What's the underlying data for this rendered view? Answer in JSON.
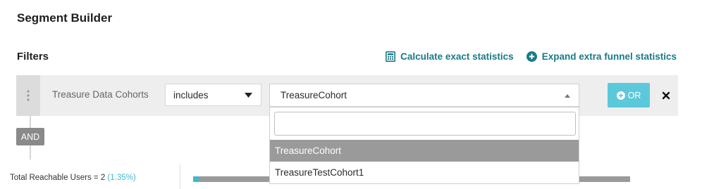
{
  "page": {
    "title": "Segment Builder"
  },
  "filters": {
    "heading": "Filters",
    "actions": {
      "calculate_label": "Calculate exact statistics",
      "expand_label": "Expand extra funnel statistics"
    }
  },
  "filter_row": {
    "label": "Treasure Data Cohorts",
    "operator": "includes",
    "value": "TreasureCohort",
    "or_label": "OR",
    "remove_symbol": "×"
  },
  "connector_label": "AND",
  "dropdown": {
    "search_value": "",
    "options": [
      "TreasureCohort",
      "TreasureTestCohort1"
    ],
    "highlighted_index": 0
  },
  "reach": {
    "prefix": "Total Reachable Users = ",
    "count": "2",
    "percent": "(1.35%)",
    "fraction": 0.0135
  },
  "colors": {
    "accent_teal": "#1a7a88",
    "button_cyan": "#5bc9da",
    "highlight_gray": "#9a9a9a"
  },
  "icons": {
    "calculate": "calculator-icon",
    "expand": "plus-circle-icon",
    "drag": "drag-handle-icon",
    "dropdown_caret": "caret-down-icon",
    "open_caret": "caret-up-icon",
    "or_plus": "plus-circle-icon",
    "remove": "close-icon"
  }
}
